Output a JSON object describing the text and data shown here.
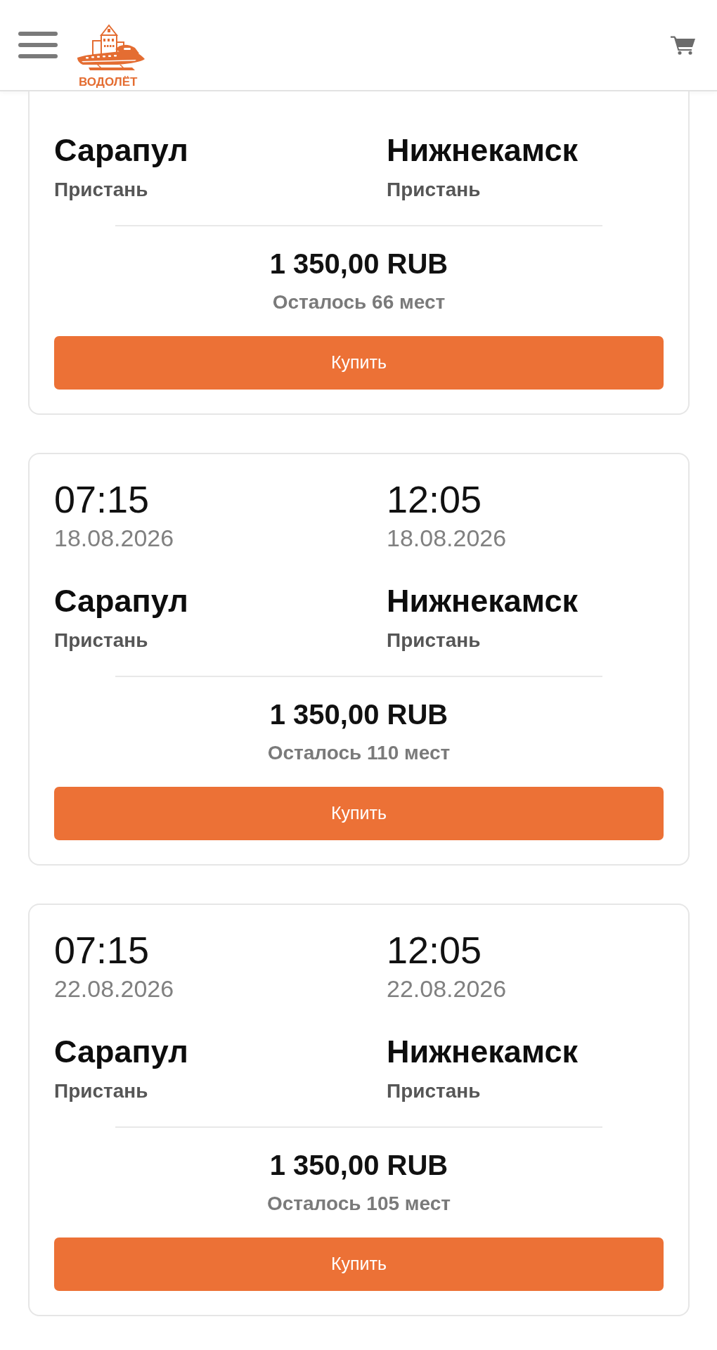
{
  "header": {
    "logo_text": "ВОДОЛЁТ"
  },
  "trips": [
    {
      "departure": {
        "city": "Сарапул",
        "pier": "Пристань"
      },
      "arrival": {
        "city": "Нижнекамск",
        "pier": "Пристань"
      },
      "price": "1 350,00 RUB",
      "seats_left": "Осталось 66 мест",
      "button": "Купить"
    },
    {
      "departure": {
        "time": "07:15",
        "date": "18.08.2026",
        "city": "Сарапул",
        "pier": "Пристань"
      },
      "arrival": {
        "time": "12:05",
        "date": "18.08.2026",
        "city": "Нижнекамск",
        "pier": "Пристань"
      },
      "price": "1 350,00 RUB",
      "seats_left": "Осталось 110 мест",
      "button": "Купить"
    },
    {
      "departure": {
        "time": "07:15",
        "date": "22.08.2026",
        "city": "Сарапул",
        "pier": "Пристань"
      },
      "arrival": {
        "time": "12:05",
        "date": "22.08.2026",
        "city": "Нижнекамск",
        "pier": "Пристань"
      },
      "price": "1 350,00 RUB",
      "seats_left": "Осталось 105 мест",
      "button": "Купить"
    }
  ]
}
